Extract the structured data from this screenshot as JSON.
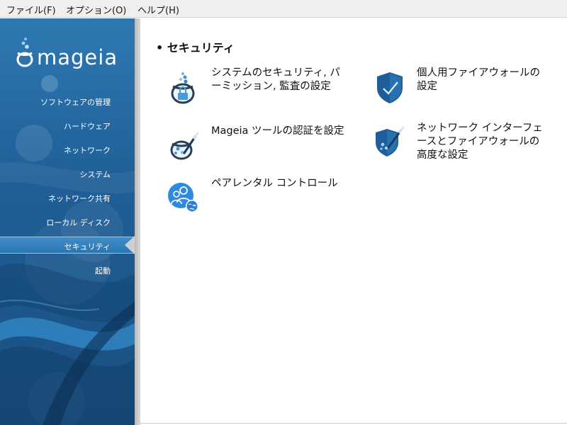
{
  "menubar": {
    "items": [
      {
        "label": "ファイル(F)"
      },
      {
        "label": "オプション(O)"
      },
      {
        "label": "ヘルプ(H)"
      }
    ]
  },
  "sidebar": {
    "logo_text": "mageia",
    "items": [
      {
        "label": "ソフトウェアの管理"
      },
      {
        "label": "ハードウェア"
      },
      {
        "label": "ネットワーク"
      },
      {
        "label": "システム"
      },
      {
        "label": "ネットワーク共有"
      },
      {
        "label": "ローカル ディスク"
      },
      {
        "label": "セキュリティ",
        "selected": true
      },
      {
        "label": "起動"
      }
    ]
  },
  "main": {
    "section_title": "• セキュリティ",
    "tools": [
      {
        "label": "システムのセキュリティ, パーミッション, 監査の設定",
        "icon": "system-security-icon"
      },
      {
        "label": "個人用ファイアウォールの設定",
        "icon": "firewall-shield-icon"
      },
      {
        "label": "Mageia ツールの認証を設定",
        "icon": "tool-authentication-icon"
      },
      {
        "label": "ネットワーク インターフェースとファイアウォールの高度な設定",
        "icon": "network-firewall-icon"
      },
      {
        "label": "ペアレンタル コントロール",
        "icon": "parental-control-icon"
      }
    ]
  },
  "colors": {
    "sidebar_blue": "#1f5f97",
    "selection_blue": "#3f8ec9",
    "shield_blue": "#1f5e99"
  }
}
